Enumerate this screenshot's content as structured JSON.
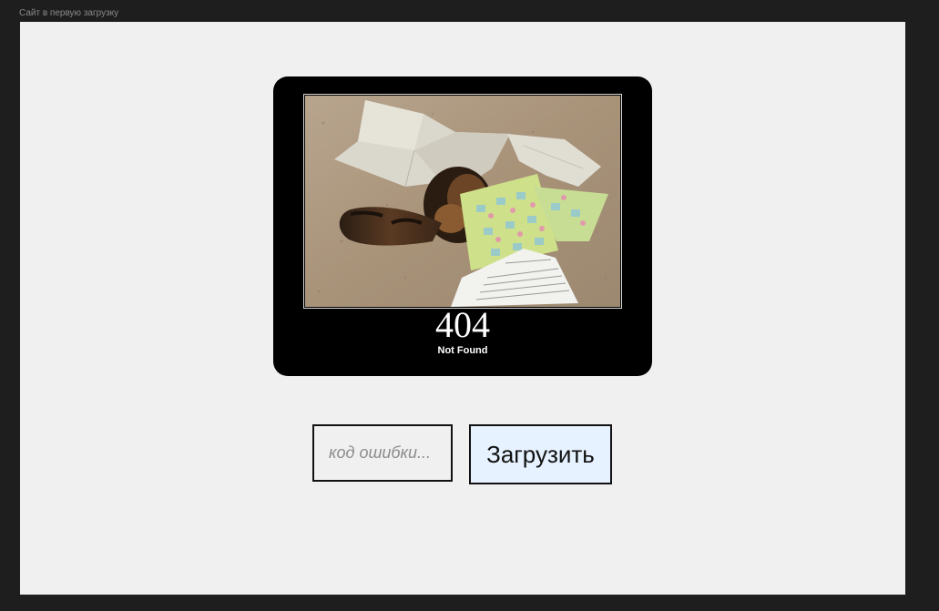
{
  "frame": {
    "title": "Сайт в первую загрузку"
  },
  "card": {
    "code": "404",
    "text": "Not Found"
  },
  "form": {
    "input_placeholder": "код ошибки...",
    "input_value": "",
    "button_label": "Загрузить"
  },
  "colors": {
    "page_bg": "#1e1e1e",
    "frame_bg": "#f0f0f0",
    "card_bg": "#000000",
    "button_bg": "#e6f2ff",
    "border": "#111111"
  }
}
